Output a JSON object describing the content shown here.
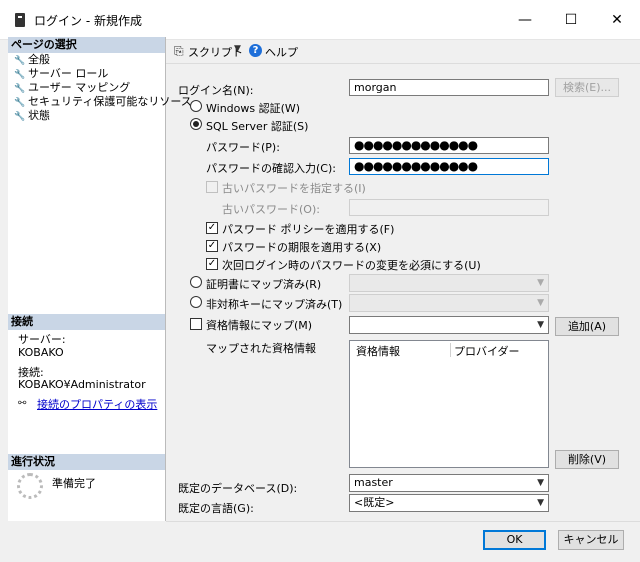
{
  "window": {
    "title": "ログイン - 新規作成",
    "minimize_glyph": "—",
    "maximize_glyph": "☐",
    "close_glyph": "✕"
  },
  "left": {
    "select_page_header": "ページの選択",
    "pages": [
      {
        "label": "全般"
      },
      {
        "label": "サーバー ロール"
      },
      {
        "label": "ユーザー マッピング"
      },
      {
        "label": "セキュリティ保護可能なリソース"
      },
      {
        "label": "状態"
      }
    ],
    "connection_header": "接続",
    "server_label": "サーバー:",
    "server_value": "KOBAKO",
    "connection_label": "接続:",
    "connection_value": "KOBAKO¥Administrator",
    "view_connection_props": "接続のプロパティの表示",
    "progress_header": "進行状況",
    "progress_status": "準備完了"
  },
  "toolbar": {
    "script_label": "スクリプト",
    "help_label": "ヘルプ"
  },
  "form": {
    "login_name_label": "ログイン名(N):",
    "login_name_value": "morgan",
    "search_button": "検索(E)...",
    "windows_auth_label": "Windows 認証(W)",
    "sql_auth_label": "SQL Server 認証(S)",
    "password_label": "パスワード(P):",
    "password_value": "●●●●●●●●●●●●●",
    "confirm_password_label": "パスワードの確認入力(C):",
    "confirm_password_value": "●●●●●●●●●●●●●",
    "specify_old_password_label": "古いパスワードを指定する(I)",
    "old_password_label": "古いパスワード(O):",
    "enforce_policy_label": "パスワード ポリシーを適用する(F)",
    "enforce_expiration_label": "パスワードの期限を適用する(X)",
    "must_change_label": "次回ログイン時のパスワードの変更を必須にする(U)",
    "cert_mapped_label": "証明書にマップ済み(R)",
    "asym_key_mapped_label": "非対称キーにマップ済み(T)",
    "map_credential_label": "資格情報にマップ(M)",
    "add_button": "追加(A)",
    "mapped_credentials_label": "マップされた資格情報",
    "cred_col_credential": "資格情報",
    "cred_col_provider": "プロバイダー",
    "remove_button": "削除(V)",
    "default_db_label": "既定のデータベース(D):",
    "default_db_value": "master",
    "default_lang_label": "既定の言語(G):",
    "default_lang_value": "<既定>"
  },
  "footer": {
    "ok_button": "OK",
    "cancel_button": "キャンセル"
  }
}
